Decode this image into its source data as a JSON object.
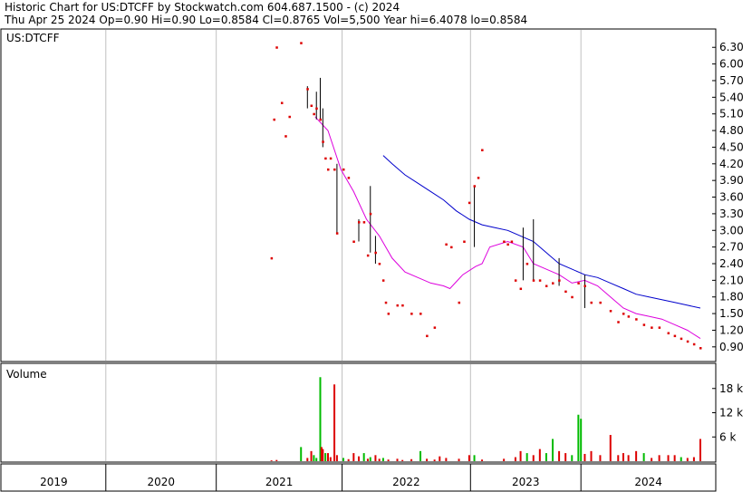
{
  "header": {
    "line1": "Historic Chart for US:DTCFF by Stockwatch.com 604.687.1500 - (c) 2024",
    "line2": "Thu Apr 25 2024   Op=0.90   Hi=0.90   Lo=0.8584   Cl=0.8765   Vol=5,500   Year hi=6.4078   lo=0.8584"
  },
  "chart_data": [
    {
      "type": "line",
      "title": "US:DTCFF",
      "price_unit": "USD",
      "ylim": [
        0.75,
        6.5
      ],
      "y_ticks": [
        "6.30",
        "6.00",
        "5.70",
        "5.40",
        "5.10",
        "4.80",
        "4.50",
        "4.20",
        "3.90",
        "3.60",
        "3.30",
        "3.00",
        "2.70",
        "2.40",
        "2.10",
        "1.80",
        "1.50",
        "1.20",
        "0.90"
      ],
      "x_labels": [
        "2019",
        "2020",
        "2021",
        "2022",
        "2023",
        "2024"
      ],
      "xlim": [
        2018.86,
        2024.42
      ],
      "x_boundaries": [
        2019.67,
        2020.53,
        2021.51,
        2022.51,
        2023.37
      ],
      "daily_price": [
        [
          2020.96,
          2.5
        ],
        [
          2020.98,
          5.0
        ],
        [
          2021.0,
          6.3
        ],
        [
          2021.04,
          5.3
        ],
        [
          2021.07,
          4.7
        ],
        [
          2021.1,
          5.05
        ],
        [
          2021.19,
          6.38
        ],
        [
          2021.24,
          5.55
        ],
        [
          2021.27,
          5.25
        ],
        [
          2021.29,
          5.1
        ],
        [
          2021.31,
          5.2
        ],
        [
          2021.34,
          5.0
        ],
        [
          2021.36,
          4.6
        ],
        [
          2021.38,
          4.3
        ],
        [
          2021.4,
          4.1
        ],
        [
          2021.42,
          4.3
        ],
        [
          2021.45,
          4.1
        ],
        [
          2021.47,
          2.95
        ],
        [
          2021.52,
          4.1
        ],
        [
          2021.56,
          3.95
        ],
        [
          2021.6,
          2.8
        ],
        [
          2021.64,
          3.15
        ],
        [
          2021.68,
          3.15
        ],
        [
          2021.71,
          2.55
        ],
        [
          2021.73,
          3.3
        ],
        [
          2021.77,
          2.6
        ],
        [
          2021.8,
          2.4
        ],
        [
          2021.83,
          2.1
        ],
        [
          2021.85,
          1.7
        ],
        [
          2021.87,
          1.5
        ],
        [
          2021.94,
          1.65
        ],
        [
          2021.98,
          1.65
        ],
        [
          2022.05,
          1.5
        ],
        [
          2022.12,
          1.5
        ],
        [
          2022.17,
          1.1
        ],
        [
          2022.23,
          1.25
        ],
        [
          2022.32,
          2.75
        ],
        [
          2022.36,
          2.7
        ],
        [
          2022.42,
          1.7
        ],
        [
          2022.46,
          2.8
        ],
        [
          2022.5,
          3.5
        ],
        [
          2022.54,
          3.8
        ],
        [
          2022.57,
          3.95
        ],
        [
          2022.6,
          4.45
        ],
        [
          2022.77,
          2.8
        ],
        [
          2022.8,
          2.75
        ],
        [
          2022.83,
          2.8
        ],
        [
          2022.86,
          2.1
        ],
        [
          2022.9,
          1.95
        ],
        [
          2022.95,
          2.4
        ],
        [
          2023.0,
          2.1
        ],
        [
          2023.05,
          2.1
        ],
        [
          2023.1,
          2.0
        ],
        [
          2023.15,
          2.05
        ],
        [
          2023.2,
          2.1
        ],
        [
          2023.25,
          1.9
        ],
        [
          2023.3,
          1.8
        ],
        [
          2023.35,
          2.05
        ],
        [
          2023.4,
          2.0
        ],
        [
          2023.45,
          1.7
        ],
        [
          2023.52,
          1.7
        ],
        [
          2023.6,
          1.55
        ],
        [
          2023.66,
          1.35
        ],
        [
          2023.7,
          1.5
        ],
        [
          2023.74,
          1.45
        ],
        [
          2023.8,
          1.4
        ],
        [
          2023.86,
          1.3
        ],
        [
          2023.92,
          1.25
        ],
        [
          2023.98,
          1.25
        ],
        [
          2024.05,
          1.15
        ],
        [
          2024.1,
          1.1
        ],
        [
          2024.15,
          1.05
        ],
        [
          2024.2,
          1.0
        ],
        [
          2024.25,
          0.95
        ],
        [
          2024.3,
          0.88
        ]
      ],
      "ranges": [
        [
          2021.24,
          5.2,
          5.6
        ],
        [
          2021.31,
          5.0,
          5.5
        ],
        [
          2021.34,
          5.0,
          5.75
        ],
        [
          2021.36,
          4.5,
          5.2
        ],
        [
          2021.47,
          2.95,
          4.2
        ],
        [
          2021.64,
          2.8,
          3.2
        ],
        [
          2021.73,
          2.6,
          3.8
        ],
        [
          2021.77,
          2.4,
          2.9
        ],
        [
          2022.54,
          2.7,
          3.8
        ],
        [
          2022.92,
          2.1,
          3.05
        ],
        [
          2023.0,
          2.1,
          3.2
        ],
        [
          2023.2,
          2.0,
          2.5
        ],
        [
          2023.4,
          1.6,
          2.2
        ]
      ],
      "series": [
        {
          "name": "",
          "color": "#dd00dd",
          "values": [
            [
              2021.3,
              5.05
            ],
            [
              2021.4,
              4.8
            ],
            [
              2021.5,
              4.1
            ],
            [
              2021.6,
              3.7
            ],
            [
              2021.7,
              3.2
            ],
            [
              2021.8,
              2.9
            ],
            [
              2021.9,
              2.5
            ],
            [
              2022.0,
              2.25
            ],
            [
              2022.1,
              2.15
            ],
            [
              2022.2,
              2.05
            ],
            [
              2022.3,
              2.0
            ],
            [
              2022.35,
              1.95
            ],
            [
              2022.45,
              2.2
            ],
            [
              2022.55,
              2.35
            ],
            [
              2022.6,
              2.4
            ],
            [
              2022.66,
              2.7
            ],
            [
              2022.8,
              2.8
            ],
            [
              2022.92,
              2.7
            ],
            [
              2023.0,
              2.4
            ],
            [
              2023.1,
              2.3
            ],
            [
              2023.2,
              2.2
            ],
            [
              2023.3,
              2.05
            ],
            [
              2023.4,
              2.1
            ],
            [
              2023.5,
              2.0
            ],
            [
              2023.6,
              1.8
            ],
            [
              2023.7,
              1.6
            ],
            [
              2023.8,
              1.5
            ],
            [
              2023.9,
              1.45
            ],
            [
              2024.0,
              1.4
            ],
            [
              2024.1,
              1.3
            ],
            [
              2024.2,
              1.2
            ],
            [
              2024.3,
              1.05
            ]
          ]
        },
        {
          "name": "",
          "color": "#0000cc",
          "values": [
            [
              2021.83,
              4.35
            ],
            [
              2021.9,
              4.2
            ],
            [
              2022.0,
              4.0
            ],
            [
              2022.1,
              3.85
            ],
            [
              2022.2,
              3.7
            ],
            [
              2022.3,
              3.55
            ],
            [
              2022.4,
              3.35
            ],
            [
              2022.5,
              3.2
            ],
            [
              2022.6,
              3.1
            ],
            [
              2022.7,
              3.05
            ],
            [
              2022.8,
              3.0
            ],
            [
              2022.9,
              2.9
            ],
            [
              2023.0,
              2.8
            ],
            [
              2023.1,
              2.6
            ],
            [
              2023.2,
              2.4
            ],
            [
              2023.3,
              2.3
            ],
            [
              2023.4,
              2.2
            ],
            [
              2023.5,
              2.15
            ],
            [
              2023.6,
              2.05
            ],
            [
              2023.7,
              1.95
            ],
            [
              2023.8,
              1.85
            ],
            [
              2023.9,
              1.8
            ],
            [
              2024.0,
              1.75
            ],
            [
              2024.1,
              1.7
            ],
            [
              2024.2,
              1.65
            ],
            [
              2024.3,
              1.6
            ]
          ]
        }
      ]
    },
    {
      "type": "bar",
      "title": "Volume",
      "unit": "shares",
      "ylim": [
        0,
        24000
      ],
      "y_ticks": [
        "18 k",
        "12 k",
        "6 k"
      ],
      "y_tick_values": [
        18000,
        12000,
        6000
      ],
      "values": [
        [
          2020.96,
          200,
          "red"
        ],
        [
          2021.0,
          300,
          "red"
        ],
        [
          2021.19,
          3500,
          "green"
        ],
        [
          2021.24,
          800,
          "red"
        ],
        [
          2021.27,
          2500,
          "red"
        ],
        [
          2021.29,
          1500,
          "green"
        ],
        [
          2021.31,
          800,
          "green"
        ],
        [
          2021.34,
          20800,
          "green"
        ],
        [
          2021.35,
          3500,
          "red"
        ],
        [
          2021.36,
          3000,
          "red"
        ],
        [
          2021.38,
          2000,
          "green"
        ],
        [
          2021.4,
          2000,
          "red"
        ],
        [
          2021.42,
          1000,
          "red"
        ],
        [
          2021.45,
          19000,
          "red"
        ],
        [
          2021.47,
          1500,
          "red"
        ],
        [
          2021.52,
          800,
          "green"
        ],
        [
          2021.56,
          500,
          "red"
        ],
        [
          2021.6,
          2000,
          "red"
        ],
        [
          2021.64,
          1200,
          "red"
        ],
        [
          2021.68,
          2000,
          "green"
        ],
        [
          2021.71,
          600,
          "red"
        ],
        [
          2021.73,
          1000,
          "green"
        ],
        [
          2021.77,
          1500,
          "red"
        ],
        [
          2021.8,
          600,
          "red"
        ],
        [
          2021.83,
          800,
          "green"
        ],
        [
          2021.87,
          400,
          "red"
        ],
        [
          2021.94,
          600,
          "red"
        ],
        [
          2021.98,
          300,
          "red"
        ],
        [
          2022.05,
          500,
          "red"
        ],
        [
          2022.12,
          2500,
          "green"
        ],
        [
          2022.17,
          600,
          "red"
        ],
        [
          2022.23,
          400,
          "red"
        ],
        [
          2022.27,
          1200,
          "red"
        ],
        [
          2022.32,
          800,
          "red"
        ],
        [
          2022.42,
          600,
          "red"
        ],
        [
          2022.5,
          1500,
          "red"
        ],
        [
          2022.54,
          1500,
          "green"
        ],
        [
          2022.6,
          400,
          "red"
        ],
        [
          2022.77,
          600,
          "red"
        ],
        [
          2022.86,
          1000,
          "red"
        ],
        [
          2022.9,
          2500,
          "red"
        ],
        [
          2022.95,
          2000,
          "green"
        ],
        [
          2023.0,
          1500,
          "red"
        ],
        [
          2023.05,
          3000,
          "red"
        ],
        [
          2023.1,
          2000,
          "green"
        ],
        [
          2023.15,
          5500,
          "green"
        ],
        [
          2023.2,
          2500,
          "red"
        ],
        [
          2023.25,
          2000,
          "red"
        ],
        [
          2023.3,
          1500,
          "green"
        ],
        [
          2023.35,
          11500,
          "green"
        ],
        [
          2023.37,
          10500,
          "green"
        ],
        [
          2023.4,
          1800,
          "red"
        ],
        [
          2023.45,
          2500,
          "red"
        ],
        [
          2023.52,
          1500,
          "red"
        ],
        [
          2023.6,
          6500,
          "red"
        ],
        [
          2023.66,
          1500,
          "red"
        ],
        [
          2023.7,
          2000,
          "red"
        ],
        [
          2023.74,
          1500,
          "red"
        ],
        [
          2023.8,
          2500,
          "red"
        ],
        [
          2023.86,
          2000,
          "green"
        ],
        [
          2023.92,
          800,
          "red"
        ],
        [
          2023.98,
          1500,
          "red"
        ],
        [
          2024.05,
          1500,
          "red"
        ],
        [
          2024.1,
          1500,
          "red"
        ],
        [
          2024.15,
          1000,
          "green"
        ],
        [
          2024.2,
          800,
          "red"
        ],
        [
          2024.25,
          1000,
          "red"
        ],
        [
          2024.3,
          5500,
          "red"
        ]
      ]
    }
  ],
  "colors": {
    "up_bar": "#00bb00",
    "down_bar": "#dd0000",
    "price_dot": "#dd0000",
    "grid": "#c0c0c0",
    "price_ticks": "#000000"
  }
}
